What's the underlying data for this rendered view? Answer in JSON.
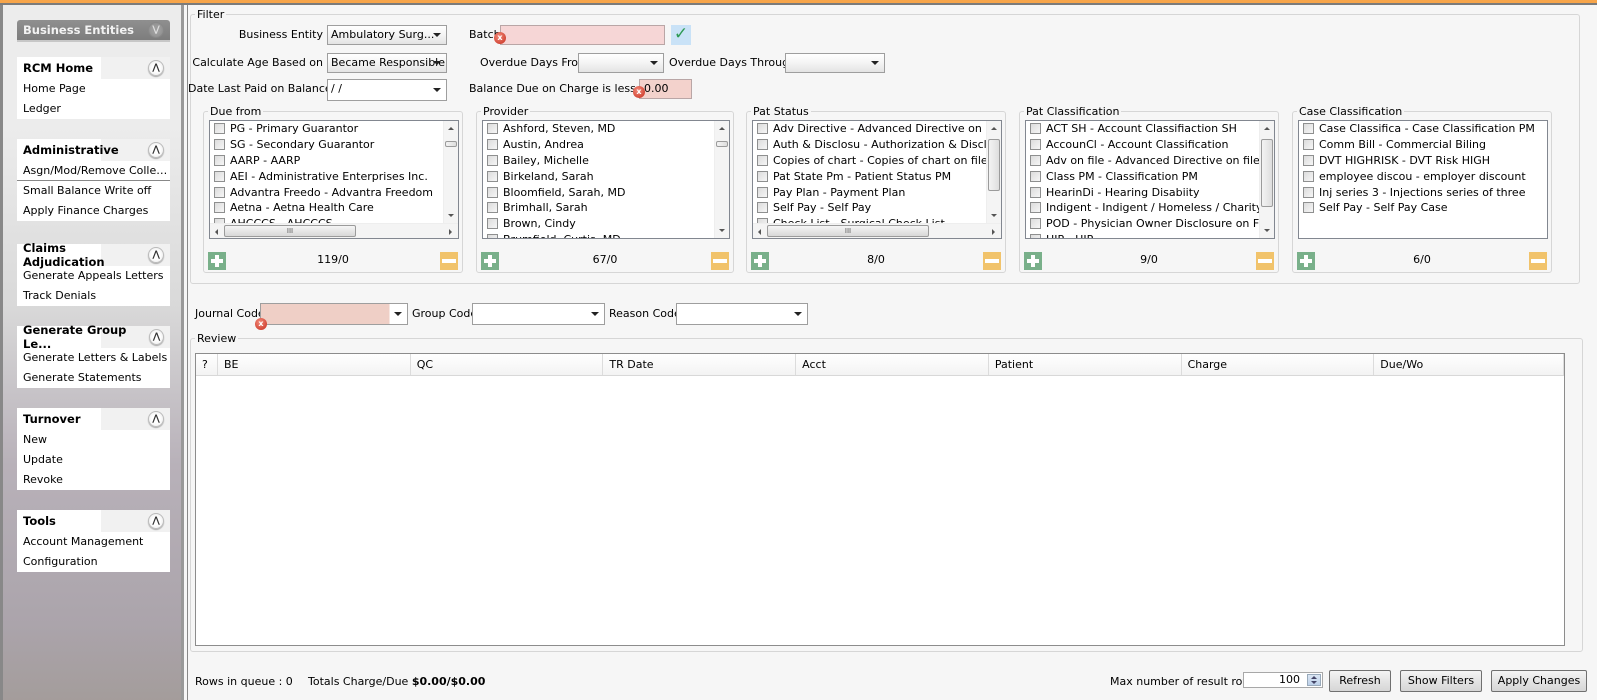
{
  "sidebar": {
    "business_entities": {
      "title": "Business Entities"
    },
    "groups": [
      {
        "title": "RCM Home",
        "items": [
          "Home Page",
          "Ledger"
        ]
      },
      {
        "title": "Administrative",
        "items": [
          "Asgn/Mod/Remove Collecto...",
          "Small Balance Write off",
          "Apply Finance Charges"
        ]
      },
      {
        "title": "Claims Adjudication",
        "items": [
          "Generate Appeals Letters",
          "Track Denials"
        ]
      },
      {
        "title": "Generate Group Le...",
        "items": [
          "Generate Letters & Labels",
          "Generate Statements"
        ]
      },
      {
        "title": "Turnover",
        "items": [
          "New",
          "Update",
          "Revoke"
        ]
      },
      {
        "title": "Tools",
        "items": [
          "Account Management",
          "Configuration"
        ]
      }
    ]
  },
  "filter": {
    "legend": "Filter",
    "business_entity": {
      "label": "Business Entity",
      "value": "Ambulatory Surg..."
    },
    "batch": {
      "label": "Batch",
      "value": ""
    },
    "calc_age": {
      "label": "Calculate Age Based on",
      "value": "Became Responsible"
    },
    "overdue_from": {
      "label": "Overdue Days From",
      "value": ""
    },
    "overdue_through": {
      "label": "Overdue Days Through",
      "value": ""
    },
    "date_last_paid": {
      "label": "Date Last Paid on Balance",
      "value": " /  /"
    },
    "balance_due": {
      "label": "Balance Due on Charge is less than",
      "value": "0.00"
    },
    "panels": [
      {
        "legend": "Due from",
        "count": "119/0",
        "items": [
          "PG - Primary Guarantor",
          "SG - Secondary Guarantor",
          "AARP - AARP",
          "AEI - Administrative Enterprises Inc.",
          "Advantra Freedo - Advantra Freedom",
          "Aetna  - Aetna Health Care",
          "AHCCCS - AHCCCS"
        ]
      },
      {
        "legend": "Provider",
        "count": "67/0",
        "items": [
          "Ashford, Steven, MD",
          "Austin, Andrea",
          "Bailey, Michelle",
          "Birkeland, Sarah",
          "Bloomfield, Sarah, MD",
          "Brimhall, Sarah",
          "Brown, Cindy",
          "Brumfield, Curtis, MD"
        ]
      },
      {
        "legend": "Pat Status",
        "count": "8/0",
        "items": [
          "Adv Directive - Advanced Directive on File",
          "Auth & Disclosu - Authorization & Disclosure Ir",
          "Copies of chart - Copies of chart on file",
          "Pat State Pm  - Patient Status PM",
          "Pay Plan - Payment Plan",
          "Self Pay - Self Pay",
          "Check List - Surgical Check List"
        ]
      },
      {
        "legend": "Pat Classification",
        "count": "9/0",
        "items": [
          "ACT SH - Account Classifiaction SH",
          "AccounCl - Account Classification",
          "Adv on file - Advanced Directive on file",
          "Class PM  - Classification  PM",
          "HearinDi - Hearing Disabiity",
          "Indigent  - Indigent / Homeless / Charity",
          "POD - Physician Owner Disclosure on File",
          "HIP - HIP"
        ]
      },
      {
        "legend": "Case Classification",
        "count": "6/0",
        "items": [
          "Case Classifica - Case Classification PM",
          "Comm Bill - Commercial Biling",
          "DVT HIGHRISK - DVT Risk HIGH",
          "employee discou - employer discount",
          "Inj series 3 - Injections series of three",
          "Self Pay - Self Pay Case"
        ]
      }
    ]
  },
  "codes": {
    "journal": {
      "label": "Journal Code",
      "value": ""
    },
    "group": {
      "label": "Group Code",
      "value": ""
    },
    "reason": {
      "label": "Reason Code",
      "value": ""
    }
  },
  "review": {
    "legend": "Review",
    "columns": [
      "?",
      "BE",
      "QC",
      "TR Date",
      "Acct",
      "Patient",
      "Charge",
      "Due/Wo"
    ],
    "rows": []
  },
  "footer": {
    "rows_in_queue": "Rows in queue : 0",
    "totals_label": "Totals Charge/Due",
    "totals_value": "$0.00/$0.00",
    "max_rows_label": "Max number of result rows",
    "max_rows_value": "100",
    "refresh": "Refresh",
    "show_filters": "Show Filters",
    "apply_changes": "Apply Changes"
  }
}
